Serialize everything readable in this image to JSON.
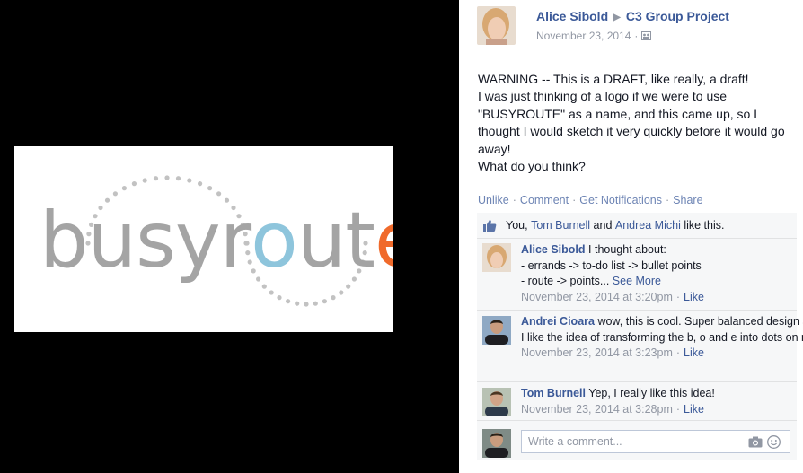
{
  "photo": {
    "logo_parts": [
      "busyr",
      "o",
      "ut",
      "e"
    ],
    "colors": {
      "grey": "#a4a4a4",
      "blue": "#8ec5dc",
      "orange": "#f06a2b"
    }
  },
  "post": {
    "author": "Alice Sibold",
    "group": "C3 Group Project",
    "date": "November 23, 2014",
    "privacy_icon": "group-privacy-icon",
    "body": [
      "WARNING -- This is a DRAFT, like really, a draft!",
      "I was just thinking of a logo if we were to use \"BUSYROUTE\" as a name, and this came up, so I thought I would sketch it very quickly before it would go away!",
      "What do you think?"
    ],
    "actions": [
      "Unlike",
      "Comment",
      "Get Notifications",
      "Share"
    ]
  },
  "likes": {
    "you": "You,",
    "person1": "Tom Burnell",
    "and": "and",
    "person2": "Andrea Michi",
    "suffix": "like this."
  },
  "comments": [
    {
      "author": "Alice Sibold",
      "lines": [
        "I thought about:",
        "- errands -> to-do list -> bullet points",
        "- route -> points..."
      ],
      "see_more": "See More",
      "time": "November 23, 2014 at 3:20pm",
      "like": "Like"
    },
    {
      "author": "Andrei Cioara",
      "text": "wow, this is cool. Super balanced design and I like the idea of transforming the b, o and e into dots on map",
      "time": "November 23, 2014 at 3:23pm",
      "like": "Like"
    },
    {
      "author": "Tom Burnell",
      "text": "Yep, I really like this idea!",
      "time": "November 23, 2014 at 3:28pm",
      "like": "Like"
    }
  ],
  "reply": {
    "placeholder": "Write a comment..."
  },
  "theme": {
    "link": "#3b5998",
    "muted": "#9197a3",
    "panel_bg": "#f6f7f8"
  }
}
